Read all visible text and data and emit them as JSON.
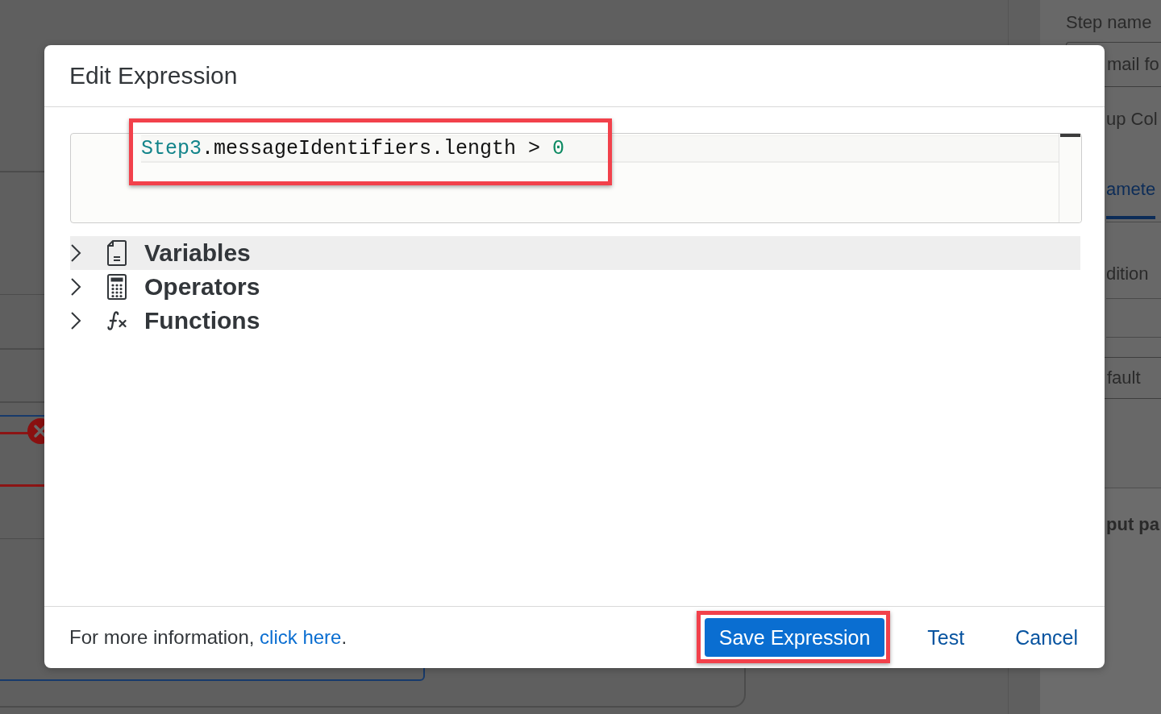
{
  "backdrop": {
    "panel": {
      "label": "Step name",
      "name_value": "mail fo",
      "group_label": "up Col",
      "tabs": [
        {
          "label": "amete",
          "selected": true
        }
      ],
      "condition_label": "dition",
      "default_value": "fault",
      "section_title": "put pa"
    }
  },
  "dialog": {
    "title": "Edit Expression",
    "editor": {
      "annotated": true,
      "lines": [
        {
          "tokens": [
            {
              "kind": "identifier",
              "text": "Step3"
            },
            {
              "kind": "plain",
              "text": ".messageIdentifiers.length > "
            },
            {
              "kind": "number",
              "text": "0"
            }
          ]
        }
      ]
    },
    "tree": [
      {
        "label": "Variables",
        "expanded": false,
        "selected": true
      },
      {
        "label": "Operators",
        "expanded": false,
        "selected": false
      },
      {
        "label": "Functions",
        "expanded": false,
        "selected": false
      }
    ],
    "footer": {
      "info": "For more information, ",
      "link": "click here",
      "info_end": "."
    },
    "buttons": [
      {
        "label": "Save Expression",
        "kind": "primary",
        "annotated": true
      },
      {
        "label": "Test",
        "kind": "transparent",
        "annotated": false
      },
      {
        "label": "Cancel",
        "kind": "transparent",
        "annotated": false
      }
    ]
  }
}
